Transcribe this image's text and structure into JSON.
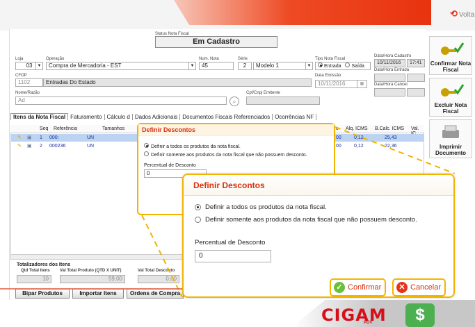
{
  "header": {
    "voltar_label": "Volta"
  },
  "status": {
    "label": "Status Nota Fiscal",
    "value": "Em Cadastro"
  },
  "form": {
    "loja_label": "Loja",
    "loja_value": "03",
    "operacao_label": "Operação",
    "operacao_value": "Compra de Mercadoria - EST",
    "num_nota_label": "Num. Nota",
    "num_nota_value": "45",
    "serie_label": "Série",
    "serie_value": "2",
    "modelo_value": "Modelo 1",
    "tipo_nota_label": "Tipo Nota Fiscal",
    "tipo_entrada": "Entrada",
    "tipo_saida": "Saída",
    "cadastro_label": "Data/Hora Cadastro",
    "cadastro_date": "10/11/2016",
    "cadastro_time": "17:41",
    "entrada_label": "Data/Hora Entrada",
    "cfop_label": "CFOP",
    "cfop_code": "1102",
    "cfop_desc": "Entradas Do Estado",
    "emissao_label": "Data Emissão",
    "emissao_value": "10/11/2016",
    "cancel_label": "Data/Hora Cancel.",
    "nome_label": "Nome/Razão",
    "nome_value": "Ad",
    "cpf_label": "Cpf/Cnpj Emitente"
  },
  "tabs": [
    "Itens da Nota Fiscal",
    "Faturamento",
    "Cálculo d",
    "Dados Adicionais",
    "Documentos Fiscais Referenciados",
    "Ocorrências NF"
  ],
  "grid": {
    "headers": {
      "seq": "Seq",
      "ref": "Referência",
      "tam": "Tamanhos",
      "c": "c",
      "aliq": "Alq. ICMS",
      "bcalc": "B.Calc. ICMS",
      "val": "Val. IC"
    },
    "rows": [
      {
        "seq": "1",
        "ref": "000:",
        "un": "UN",
        "c": "00",
        "aliq": "0,12",
        "bcalc": "25,43"
      },
      {
        "seq": "2",
        "ref": "000236",
        "un": "UN",
        "c": "00",
        "aliq": "0,12",
        "bcalc": "22,36"
      }
    ]
  },
  "totals": {
    "title": "Totalizadores dos Itens",
    "qtd_label": "Qtd Total Itens",
    "qtd_value": "10",
    "prod_label": "Val Total Produto (QTD X UNIT)",
    "prod_value": "59,00",
    "desc_label": "Val Total Desconto",
    "desc_value": "0,00"
  },
  "bottom_buttons": {
    "bipar": "Bipar Produtos",
    "importar": "Importar Itens",
    "ordens": "Ordens de Compra"
  },
  "right_panel": {
    "confirmar": "Confirmar Nota Fiscal",
    "excluir": "Excluir Nota Fiscal",
    "imprimir": "Imprimir Documento"
  },
  "dialog": {
    "title": "Definir Descontos",
    "option_all": "Definir a todos os produtos da nota fiscal.",
    "option_some": "Definir somente aos produtos da nota fiscal que não possuem desconto.",
    "percent_label": "Percentual de Desconto",
    "percent_value": "0",
    "confirm": "Confirmar",
    "cancel": "Cancelar"
  },
  "footer": {
    "logo": "CIGAM",
    "pdv": "PDV",
    "dollar": "$"
  },
  "colors": {
    "accent": "#e8330f",
    "dialog_border": "#f3b400",
    "title_red": "#d9320f",
    "selected_row": "#bcd4f2"
  }
}
